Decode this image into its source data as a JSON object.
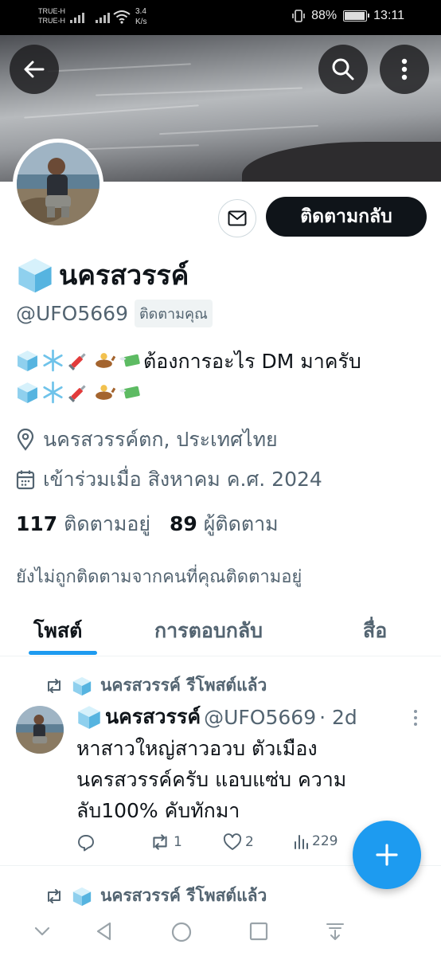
{
  "status_bar": {
    "carrier_1": "TRUE-H",
    "carrier_2": "TRUE-H",
    "speed_value": "3.4",
    "speed_unit": "K/s",
    "battery": "88%",
    "time": "13:11"
  },
  "header": {
    "back_icon": "arrow-left-icon",
    "search_icon": "search-icon",
    "more_icon": "more-vertical-icon"
  },
  "profile": {
    "display_name": "นครสวรรค์",
    "handle": "@UFO5669",
    "follows_you_badge": "ติดตามคุณ",
    "follow_back_button": "ติดตามกลับ",
    "bio_line1": "ต้องการอะไร DM มาครับ",
    "location": "นครสวรรค์ตก, ประเทศไทย",
    "joined": "เข้าร่วมเมื่อ สิงหาคม ค.ศ. 2024",
    "following_count": "117",
    "following_label": "ติดตามอยู่",
    "followers_count": "89",
    "followers_label": "ผู้ติดตาม",
    "not_followed_note": "ยังไม่ถูกติดตามจากคนที่คุณติดตามอยู่"
  },
  "tabs": [
    {
      "label": "โพสต์",
      "active": true
    },
    {
      "label": "การตอบกลับ",
      "active": false
    },
    {
      "label": "สื่อ",
      "active": false
    }
  ],
  "posts": [
    {
      "repost_label": "นครสวรรค์ รีโพสต์แล้ว",
      "author_name": "นครสวรรค์",
      "author_handle": "@UFO5669",
      "time_ago": "· 2d",
      "text": "หาสาวใหญ่สาวอวบ ตัวเมืองนครสวรรค์ครับ แอบแซ่บ ความลับ100% คับทักมา",
      "reply_count": "",
      "repost_count": "1",
      "like_count": "2",
      "view_count": "229"
    },
    {
      "repost_label": "นครสวรรค์ รีโพสต์แล้ว"
    }
  ],
  "colors": {
    "accent": "#1d9bf0",
    "text": "#0f1419",
    "secondary": "#536471"
  }
}
